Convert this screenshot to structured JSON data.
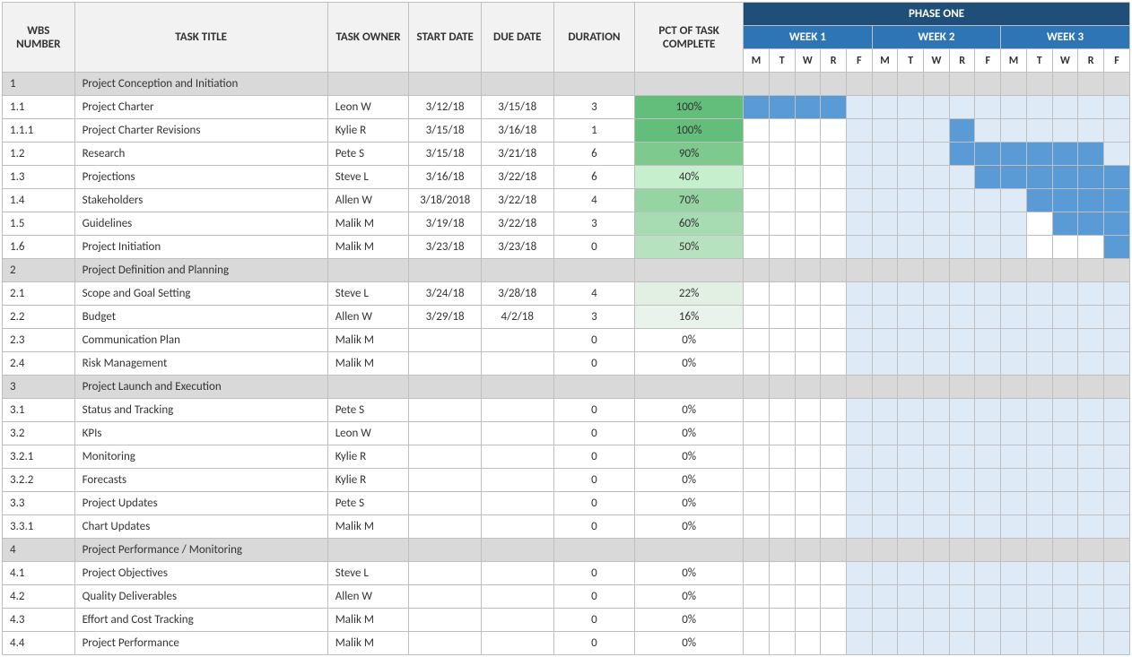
{
  "headers": {
    "wbs": "WBS NUMBER",
    "title": "TASK TITLE",
    "owner": "TASK OWNER",
    "start": "START DATE",
    "due": "DUE DATE",
    "duration": "DURATION",
    "pct": "PCT OF TASK COMPLETE",
    "phase": "PHASE ONE",
    "weeks": [
      "WEEK 1",
      "WEEK 2",
      "WEEK 3"
    ],
    "days": [
      "M",
      "T",
      "W",
      "R",
      "F",
      "M",
      "T",
      "W",
      "R",
      "F",
      "M",
      "T",
      "W",
      "R",
      "F"
    ]
  },
  "rows": [
    {
      "wbs": "1",
      "title": "Project Conception and Initiation",
      "owner": "",
      "start": "",
      "due": "",
      "dur": "",
      "pct": "",
      "section": true,
      "gantt": [
        "",
        "",
        "",
        "",
        "",
        "",
        "",
        "",
        "",
        "",
        "",
        "",
        "",
        "",
        ""
      ]
    },
    {
      "wbs": "1.1",
      "title": "Project Charter",
      "owner": "Leon W",
      "start": "3/12/18",
      "due": "3/15/18",
      "dur": "3",
      "pct": "100%",
      "pctbg": "#63be7b",
      "gantt": [
        "f",
        "f",
        "f",
        "f",
        "l",
        "l",
        "l",
        "l",
        "l",
        "l",
        "l",
        "l",
        "l",
        "l",
        "l"
      ]
    },
    {
      "wbs": "1.1.1",
      "title": "Project Charter Revisions",
      "owner": "Kylie R",
      "start": "3/15/18",
      "due": "3/16/18",
      "dur": "1",
      "pct": "100%",
      "pctbg": "#63be7b",
      "gantt": [
        "",
        "",
        "",
        "",
        "l",
        "l",
        "l",
        "l",
        "f",
        "l",
        "l",
        "l",
        "l",
        "l",
        "l"
      ]
    },
    {
      "wbs": "1.2",
      "title": "Research",
      "owner": "Pete S",
      "start": "3/15/18",
      "due": "3/21/18",
      "dur": "6",
      "pct": "90%",
      "pctbg": "#7ec98e",
      "gantt": [
        "",
        "",
        "",
        "",
        "l",
        "l",
        "l",
        "l",
        "f",
        "f",
        "f",
        "f",
        "f",
        "f",
        "l"
      ]
    },
    {
      "wbs": "1.3",
      "title": "Projections",
      "owner": "Steve L",
      "start": "3/16/18",
      "due": "3/22/18",
      "dur": "6",
      "pct": "40%",
      "pctbg": "#c6efce",
      "gantt": [
        "",
        "",
        "",
        "",
        "l",
        "l",
        "l",
        "l",
        "l",
        "f",
        "f",
        "f",
        "f",
        "f",
        "f"
      ]
    },
    {
      "wbs": "1.4",
      "title": "Stakeholders",
      "owner": "Allen W",
      "start": "3/18/2018",
      "due": "3/22/18",
      "dur": "4",
      "pct": "70%",
      "pctbg": "#97d4a4",
      "gantt": [
        "",
        "",
        "",
        "",
        "l",
        "l",
        "l",
        "l",
        "l",
        "l",
        "l",
        "f",
        "f",
        "f",
        "f"
      ]
    },
    {
      "wbs": "1.5",
      "title": "Guidelines",
      "owner": "Malik M",
      "start": "3/19/18",
      "due": "3/22/18",
      "dur": "3",
      "pct": "60%",
      "pctbg": "#a7dbb2",
      "gantt": [
        "",
        "",
        "",
        "",
        "l",
        "l",
        "l",
        "l",
        "l",
        "l",
        "l",
        "",
        "f",
        "f",
        "f"
      ]
    },
    {
      "wbs": "1.6",
      "title": "Project Initiation",
      "owner": "Malik M",
      "start": "3/23/18",
      "due": "3/23/18",
      "dur": "0",
      "pct": "50%",
      "pctbg": "#b7e2bf",
      "gantt": [
        "",
        "",
        "",
        "",
        "l",
        "l",
        "l",
        "l",
        "l",
        "l",
        "l",
        "",
        "",
        "",
        "f"
      ]
    },
    {
      "wbs": "2",
      "title": "Project Definition and Planning",
      "owner": "",
      "start": "",
      "due": "",
      "dur": "",
      "pct": "",
      "section": true,
      "gantt": [
        "",
        "",
        "",
        "",
        "",
        "",
        "",
        "",
        "",
        "",
        "",
        "",
        "",
        "",
        ""
      ]
    },
    {
      "wbs": "2.1",
      "title": "Scope and Goal Setting",
      "owner": "Steve L",
      "start": "3/24/18",
      "due": "3/28/18",
      "dur": "4",
      "pct": "22%",
      "pctbg": "#e2f0e4",
      "gantt": [
        "",
        "",
        "",
        "",
        "l",
        "l",
        "l",
        "l",
        "l",
        "l",
        "l",
        "l",
        "l",
        "l",
        "l"
      ]
    },
    {
      "wbs": "2.2",
      "title": "Budget",
      "owner": "Allen W",
      "start": "3/29/18",
      "due": "4/2/18",
      "dur": "3",
      "pct": "16%",
      "pctbg": "#e9f3eb",
      "gantt": [
        "",
        "",
        "",
        "",
        "l",
        "l",
        "l",
        "l",
        "l",
        "l",
        "l",
        "l",
        "l",
        "l",
        "l"
      ]
    },
    {
      "wbs": "2.3",
      "title": "Communication Plan",
      "owner": "Malik M",
      "start": "",
      "due": "",
      "dur": "0",
      "pct": "0%",
      "gantt": [
        "",
        "",
        "",
        "",
        "l",
        "l",
        "l",
        "l",
        "l",
        "l",
        "l",
        "l",
        "l",
        "l",
        "l"
      ]
    },
    {
      "wbs": "2.4",
      "title": "Risk Management",
      "owner": "Malik M",
      "start": "",
      "due": "",
      "dur": "0",
      "pct": "0%",
      "gantt": [
        "",
        "",
        "",
        "",
        "l",
        "l",
        "l",
        "l",
        "l",
        "l",
        "l",
        "l",
        "l",
        "l",
        "l"
      ]
    },
    {
      "wbs": "3",
      "title": "Project Launch and Execution",
      "owner": "",
      "start": "",
      "due": "",
      "dur": "",
      "pct": "",
      "section": true,
      "gantt": [
        "",
        "",
        "",
        "",
        "",
        "",
        "",
        "",
        "",
        "",
        "",
        "",
        "",
        "",
        ""
      ]
    },
    {
      "wbs": "3.1",
      "title": "Status and Tracking",
      "owner": "Pete S",
      "start": "",
      "due": "",
      "dur": "0",
      "pct": "0%",
      "gantt": [
        "",
        "",
        "",
        "",
        "l",
        "l",
        "l",
        "l",
        "l",
        "l",
        "l",
        "l",
        "l",
        "l",
        "l"
      ]
    },
    {
      "wbs": "3.2",
      "title": "KPIs",
      "owner": "Leon W",
      "start": "",
      "due": "",
      "dur": "0",
      "pct": "0%",
      "gantt": [
        "",
        "",
        "",
        "",
        "l",
        "l",
        "l",
        "l",
        "l",
        "l",
        "l",
        "l",
        "l",
        "l",
        "l"
      ]
    },
    {
      "wbs": "3.2.1",
      "title": "Monitoring",
      "owner": "Kylie R",
      "start": "",
      "due": "",
      "dur": "0",
      "pct": "0%",
      "gantt": [
        "",
        "",
        "",
        "",
        "l",
        "l",
        "l",
        "l",
        "l",
        "l",
        "l",
        "l",
        "l",
        "l",
        "l"
      ]
    },
    {
      "wbs": "3.2.2",
      "title": "Forecasts",
      "owner": "Kylie R",
      "start": "",
      "due": "",
      "dur": "0",
      "pct": "0%",
      "gantt": [
        "",
        "",
        "",
        "",
        "l",
        "l",
        "l",
        "l",
        "l",
        "l",
        "l",
        "l",
        "l",
        "l",
        "l"
      ]
    },
    {
      "wbs": "3.3",
      "title": "Project Updates",
      "owner": "Pete S",
      "start": "",
      "due": "",
      "dur": "0",
      "pct": "0%",
      "gantt": [
        "",
        "",
        "",
        "",
        "l",
        "l",
        "l",
        "l",
        "l",
        "l",
        "l",
        "l",
        "l",
        "l",
        "l"
      ]
    },
    {
      "wbs": "3.3.1",
      "title": "Chart Updates",
      "owner": "Malik M",
      "start": "",
      "due": "",
      "dur": "0",
      "pct": "0%",
      "gantt": [
        "",
        "",
        "",
        "",
        "l",
        "l",
        "l",
        "l",
        "l",
        "l",
        "l",
        "l",
        "l",
        "l",
        "l"
      ]
    },
    {
      "wbs": "4",
      "title": "Project Performance / Monitoring",
      "owner": "",
      "start": "",
      "due": "",
      "dur": "",
      "pct": "",
      "section": true,
      "gantt": [
        "",
        "",
        "",
        "",
        "",
        "",
        "",
        "",
        "",
        "",
        "",
        "",
        "",
        "",
        ""
      ]
    },
    {
      "wbs": "4.1",
      "title": "Project Objectives",
      "owner": "Steve L",
      "start": "",
      "due": "",
      "dur": "0",
      "pct": "0%",
      "gantt": [
        "",
        "",
        "",
        "",
        "l",
        "l",
        "l",
        "l",
        "l",
        "l",
        "l",
        "l",
        "l",
        "l",
        "l"
      ]
    },
    {
      "wbs": "4.2",
      "title": "Quality Deliverables",
      "owner": "Allen W",
      "start": "",
      "due": "",
      "dur": "0",
      "pct": "0%",
      "gantt": [
        "",
        "",
        "",
        "",
        "l",
        "l",
        "l",
        "l",
        "l",
        "l",
        "l",
        "l",
        "l",
        "l",
        "l"
      ]
    },
    {
      "wbs": "4.3",
      "title": "Effort and Cost Tracking",
      "owner": "Malik M",
      "start": "",
      "due": "",
      "dur": "0",
      "pct": "0%",
      "gantt": [
        "",
        "",
        "",
        "",
        "l",
        "l",
        "l",
        "l",
        "l",
        "l",
        "l",
        "l",
        "l",
        "l",
        "l"
      ]
    },
    {
      "wbs": "4.4",
      "title": "Project Performance",
      "owner": "Malik M",
      "start": "",
      "due": "",
      "dur": "0",
      "pct": "0%",
      "gantt": [
        "",
        "",
        "",
        "",
        "l",
        "l",
        "l",
        "l",
        "l",
        "l",
        "l",
        "l",
        "l",
        "l",
        "l"
      ]
    }
  ]
}
